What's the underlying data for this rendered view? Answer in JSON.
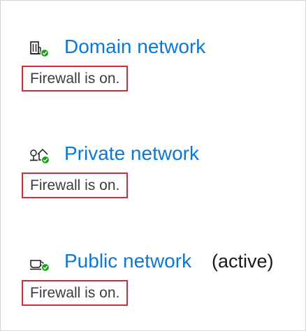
{
  "networks": [
    {
      "name": "Domain network",
      "status": "Firewall is on.",
      "active_label": "",
      "icon": "domain-building-icon",
      "badge_color": "#13a10e"
    },
    {
      "name": "Private network",
      "status": "Firewall is on.",
      "active_label": "",
      "icon": "private-home-network-icon",
      "badge_color": "#13a10e"
    },
    {
      "name": "Public network",
      "status": "Firewall is on.",
      "active_label": "(active)",
      "icon": "public-cafe-network-icon",
      "badge_color": "#13a10e"
    }
  ],
  "colors": {
    "link": "#0a78d4",
    "highlight_border": "#d42b3a",
    "status_ok": "#13a10e"
  }
}
